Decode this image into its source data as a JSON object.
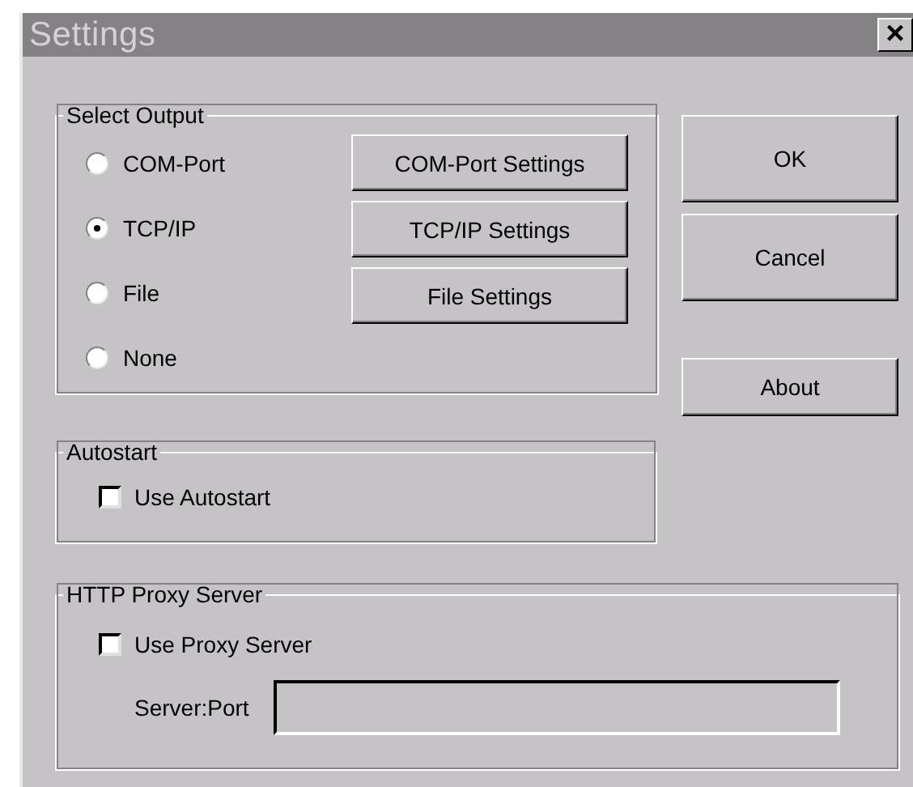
{
  "window": {
    "title": "Settings",
    "close_button": "×"
  },
  "select_output": {
    "title": "Select Output",
    "options": [
      {
        "label": "COM-Port",
        "selected": false
      },
      {
        "label": "TCP/IP",
        "selected": true
      },
      {
        "label": "File",
        "selected": false
      },
      {
        "label": "None",
        "selected": false
      }
    ],
    "buttons": [
      "COM-Port Settings",
      "TCP/IP Settings",
      "File Settings"
    ]
  },
  "dialog_buttons": [
    {
      "label": "OK",
      "kind": "tall"
    },
    {
      "label": "Cancel",
      "kind": "tall"
    },
    {
      "label": "About",
      "kind": "short"
    }
  ],
  "autostart": {
    "title": "Autostart",
    "checkbox": {
      "label": "Use Autostart",
      "checked": false
    }
  },
  "proxy": {
    "title": "HTTP Proxy Server",
    "checkbox": {
      "label": "Use Proxy Server",
      "checked": false
    },
    "field_label": "Server:Port",
    "disabled": true
  }
}
